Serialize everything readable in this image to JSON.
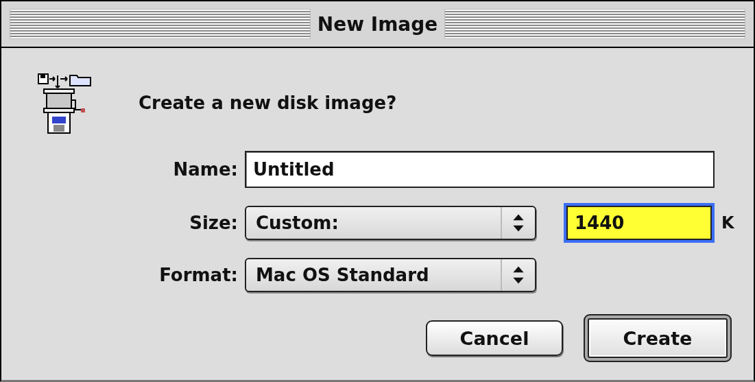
{
  "window": {
    "title": "New Image"
  },
  "prompt": "Create a new disk image?",
  "name_field": {
    "label": "Name:",
    "value": "Untitled"
  },
  "size": {
    "label": "Size:",
    "popup": "Custom:",
    "value": "1440",
    "focused": true,
    "unit": "K"
  },
  "format": {
    "label": "Format:",
    "popup": "Mac OS Standard"
  },
  "buttons": [
    {
      "label": "Cancel",
      "default": false
    },
    {
      "label": "Create",
      "default": true
    }
  ]
}
